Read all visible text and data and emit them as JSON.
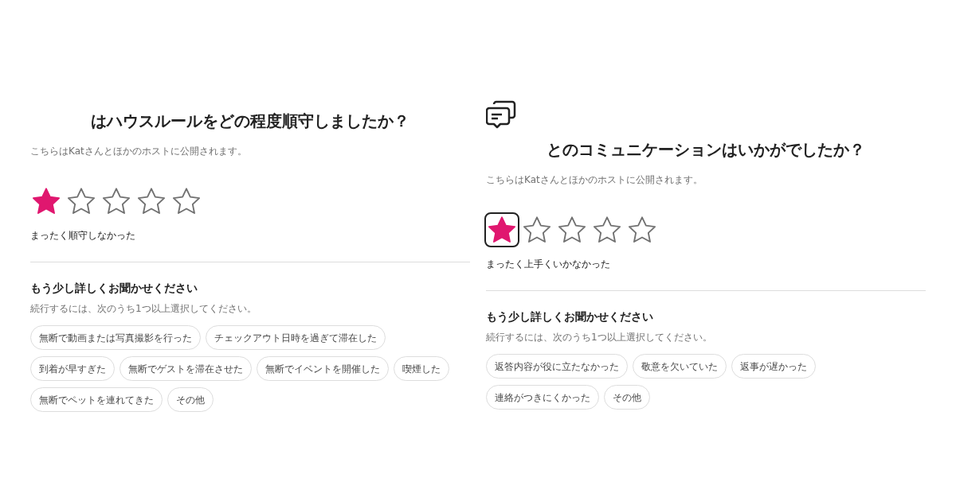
{
  "panels": [
    {
      "icon": false,
      "title": "はハウスルールをどの程度順守しましたか？",
      "subtitle": "こちらはKatさんとほかのホストに公開されます。",
      "stars": 1,
      "focused": false,
      "rating_label": "まったく順守しなかった",
      "details_title": "もう少し詳しくお聞かせください",
      "details_hint": "続行するには、次のうち1つ以上選択してください。",
      "options": [
        {
          "label": "無断で動画または写真撮影を行った",
          "selected": false
        },
        {
          "label": "チェックアウト日時を過ぎて滞在した",
          "selected": false
        },
        {
          "label": "到着が早すぎた",
          "selected": false
        },
        {
          "label": "無断でゲストを滞在させた",
          "selected": false
        },
        {
          "label": "無断でイベントを開催した",
          "selected": false
        },
        {
          "label": "喫煙した",
          "selected": false
        },
        {
          "label": "無断でペットを連れてきた",
          "selected": false
        },
        {
          "label": "その他",
          "selected": false
        }
      ]
    },
    {
      "icon": true,
      "title": "とのコミュニケーションはいかがでしたか？",
      "subtitle": "こちらはKatさんとほかのホストに公開されます。",
      "stars": 1,
      "focused": true,
      "rating_label": "まったく上手くいかなかった",
      "details_title": "もう少し詳しくお聞かせください",
      "details_hint": "続行するには、次のうち1つ以上選択してください。",
      "options": [
        {
          "label": "返答内容が役に立たなかった",
          "selected": false
        },
        {
          "label": "敬意を欠いていた",
          "selected": false
        },
        {
          "label": "返事が遅かった",
          "selected": false
        },
        {
          "label": "連絡がつきにくかった",
          "selected": false
        },
        {
          "label": "その他",
          "selected": false
        }
      ]
    }
  ]
}
